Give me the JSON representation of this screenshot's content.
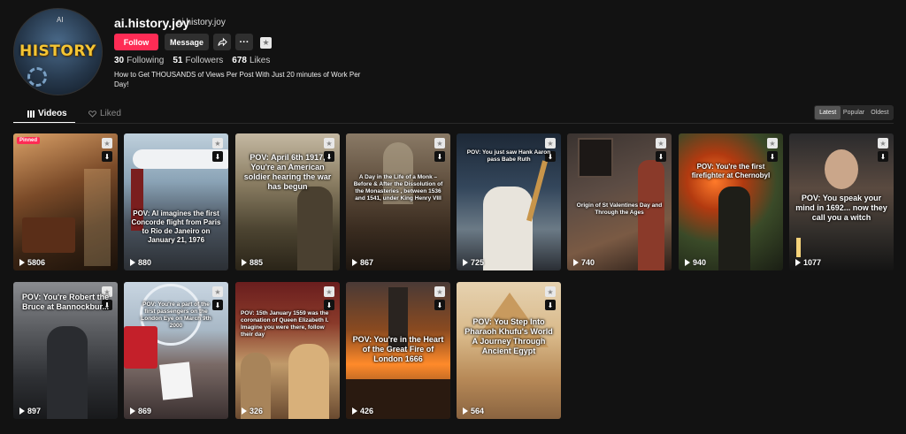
{
  "profile": {
    "avatar_text": "HISTORY",
    "avatar_mark": "AI",
    "username": "ai.history.joy",
    "handle": "ai.history.joy",
    "follow_label": "Follow",
    "message_label": "Message",
    "share_icon": "share-icon",
    "more_label": "···",
    "fav_icon": "star-icon",
    "stats": {
      "following_count": "30",
      "following_label": "Following",
      "followers_count": "51",
      "followers_label": "Followers",
      "likes_count": "678",
      "likes_label": "Likes"
    },
    "bio": "How to Get THOUSANDS of Views Per Post With Just 20 minutes of Work Per Day!"
  },
  "tabs": {
    "videos_label": "Videos",
    "liked_label": "Liked"
  },
  "sort": {
    "options": [
      "Latest",
      "Popular",
      "Oldest"
    ],
    "selected": "Latest"
  },
  "videos": [
    {
      "caption": "",
      "views": "5806",
      "pinned_label": "Pinned"
    },
    {
      "caption": "POV: AI imagines the first Concorde flight from Paris to Rio de Janeiro on January 21, 1976",
      "views": "880"
    },
    {
      "caption": "POV: April 6th 1917, You're an American soldier hearing the war has begun",
      "views": "885"
    },
    {
      "caption": "A Day in the Life of a Monk – Before & After the Dissolution of the Monasteries , between 1536 and 1541, under King Henry VIII",
      "views": "867"
    },
    {
      "caption": "POV: You just saw Hank Aaron pass Babe Ruth",
      "views": "725"
    },
    {
      "caption": "Origin of St Valentines Day and Through the Ages",
      "views": "740"
    },
    {
      "caption": "POV: You're the first firefighter at Chernobyl",
      "views": "940"
    },
    {
      "caption": "POV: You speak your mind in 1692... now they call you a witch",
      "views": "1077"
    },
    {
      "caption": "POV: You're Robert the Bruce at Bannockbur...",
      "views": "897"
    },
    {
      "caption": "POV: You're a part of the first passengers on the London Eye on March 9th 2000",
      "views": "869"
    },
    {
      "caption": "POV: 15th January 1559 was the coronation of Queen Elizabeth I. Imagine you were there, follow their day",
      "views": "326"
    },
    {
      "caption": "POV: You're in the Heart of the Great Fire of London 1666",
      "views": "426"
    },
    {
      "caption": "POV: You Step Into Pharaoh Khufu's World A Journey Through Ancient Egypt",
      "views": "564"
    }
  ]
}
